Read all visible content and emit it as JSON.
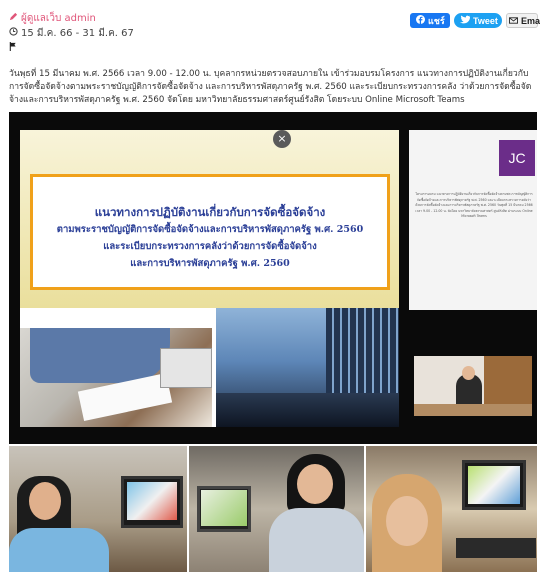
{
  "post": {
    "author": "ผู้ดูแลเว็บ admin",
    "date_range": "15 มี.ค. 66 - 31 มี.ค. 67",
    "description": "วันพุธที่ 15 มีนาคม พ.ศ. 2566 เวลา 9.00 - 12.00 น. บุคลากรหน่วยตรวจสอบภายใน เข้าร่วมอบรมโครงการ แนวทางการปฏิบัติงานเกี่ยวกับการจัดซื้อจัดจ้างตามพระราชบัญญัติการจัดซื้อจัดจ้าง และการบริหารพัสดุภาครัฐ พ.ศ. 2560 และระเบียบกระทรวงการคลัง ว่าด้วยการจัดซื้อจัดจ้างและการบริหารพัสดุภาครัฐ พ.ศ. 2560 จัดโดย มหาวิทยาลัยธรรมศาสตร์ศูนย์รังสิต โดยระบบ Online Microsoft Teams"
  },
  "share": {
    "facebook_label": "แชร์",
    "twitter_label": "Tweet",
    "email_label": "Email"
  },
  "slide": {
    "title": "แนวทางการปฏิบัติงานเกี่ยวกับการจัดซื้อจัดจ้าง",
    "line2": "ตามพระราชบัญญัติการจัดซื้อจัดจ้างและการบริหารพัสดุภาครัฐ พ.ศ. 2560",
    "line3": "และระเบียบกระทรวงการคลังว่าด้วยการจัดซื้อจัดจ้าง",
    "line4": "และการบริหารพัสดุภาครัฐ พ.ศ. 2560",
    "close_symbol": "×",
    "logo_text": "JC",
    "panel_text": "โครงการอบรม แนวทางการปฏิบัติงานเกี่ยวกับการจัดซื้อจัดจ้างตามพระราชบัญญัติการจัดซื้อจัดจ้างและการบริหารพัสดุภาครัฐ พ.ศ. 2560 และระเบียบกระทรวงการคลังว่าด้วยการจัดซื้อจัดจ้างและการบริหารพัสดุภาครัฐ พ.ศ. 2560 วันพุธที่ 15 มีนาคม 2566 เวลา 9.00 - 12.00 น. จัดโดย มหาวิทยาลัยธรรมศาสตร์ ศูนย์รังสิต ผ่านระบบ Online Microsoft Teams"
  },
  "colors": {
    "author": "#e0567a",
    "facebook": "#1877f2",
    "twitter": "#1da1f2",
    "slide_title": "#2b3f97",
    "banner_border": "#f0a11a",
    "logo_bg": "#6b2d89"
  },
  "icons": [
    "pencil-icon",
    "clock-icon",
    "flag-icon",
    "facebook-icon",
    "twitter-bird-icon",
    "email-icon",
    "close-icon"
  ]
}
